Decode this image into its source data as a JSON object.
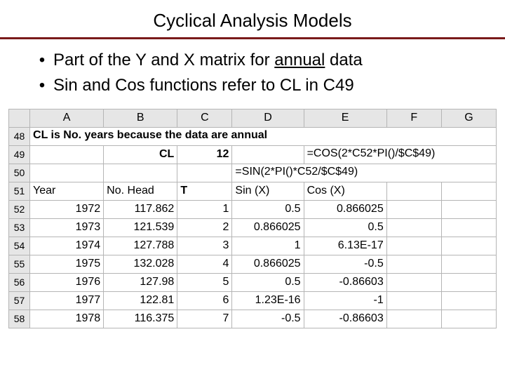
{
  "title": "Cyclical Analysis Models",
  "bullets": [
    {
      "pre": "Part of the Y and X matrix for ",
      "u": "annual",
      "post": " data"
    },
    {
      "pre": "Sin and Cos functions refer to CL in C49",
      "u": "",
      "post": ""
    }
  ],
  "columns": [
    "A",
    "B",
    "C",
    "D",
    "E",
    "F",
    "G"
  ],
  "row_numbers": [
    "48",
    "49",
    "50",
    "51",
    "52",
    "53",
    "54",
    "55",
    "56",
    "57",
    "58"
  ],
  "cells": {
    "r48": {
      "A": "CL is No. years because the data are annual"
    },
    "r49": {
      "B": "CL",
      "C": "12",
      "E": "=COS(2*C52*PI()/$C$49)"
    },
    "r50": {
      "D": "=SIN(2*PI()*C52/$C$49)"
    },
    "r51": {
      "A": "Year",
      "B": "No. Head",
      "C": "T",
      "D": "Sin (X)",
      "E": "Cos (X)"
    },
    "r52": {
      "A": "1972",
      "B": "117.862",
      "C": "1",
      "D": "0.5",
      "E": "0.866025"
    },
    "r53": {
      "A": "1973",
      "B": "121.539",
      "C": "2",
      "D": "0.866025",
      "E": "0.5"
    },
    "r54": {
      "A": "1974",
      "B": "127.788",
      "C": "3",
      "D": "1",
      "E": "6.13E-17"
    },
    "r55": {
      "A": "1975",
      "B": "132.028",
      "C": "4",
      "D": "0.866025",
      "E": "-0.5"
    },
    "r56": {
      "A": "1976",
      "B": "127.98",
      "C": "5",
      "D": "0.5",
      "E": "-0.86603"
    },
    "r57": {
      "A": "1977",
      "B": "122.81",
      "C": "6",
      "D": "1.23E-16",
      "E": "-1"
    },
    "r58": {
      "A": "1978",
      "B": "116.375",
      "C": "7",
      "D": "-0.5",
      "E": "-0.86603"
    }
  },
  "chart_data": {
    "type": "table",
    "title": "Cyclical Analysis Models — Y and X matrix (annual)",
    "note_row48": "CL is No. years because the data are annual",
    "CL": 12,
    "cos_formula": "=COS(2*C52*PI()/$C$49)",
    "sin_formula": "=SIN(2*PI()*C52/$C$49)",
    "headers": [
      "Year",
      "No. Head",
      "T",
      "Sin (X)",
      "Cos (X)"
    ],
    "rows": [
      {
        "Year": 1972,
        "No. Head": 117.862,
        "T": 1,
        "Sin (X)": 0.5,
        "Cos (X)": 0.866025
      },
      {
        "Year": 1973,
        "No. Head": 121.539,
        "T": 2,
        "Sin (X)": 0.866025,
        "Cos (X)": 0.5
      },
      {
        "Year": 1974,
        "No. Head": 127.788,
        "T": 3,
        "Sin (X)": 1,
        "Cos (X)": 6.13e-17
      },
      {
        "Year": 1975,
        "No. Head": 132.028,
        "T": 4,
        "Sin (X)": 0.866025,
        "Cos (X)": -0.5
      },
      {
        "Year": 1976,
        "No. Head": 127.98,
        "T": 5,
        "Sin (X)": 0.5,
        "Cos (X)": -0.86603
      },
      {
        "Year": 1977,
        "No. Head": 122.81,
        "T": 6,
        "Sin (X)": 1.23e-16,
        "Cos (X)": -1
      },
      {
        "Year": 1978,
        "No. Head": 116.375,
        "T": 7,
        "Sin (X)": -0.5,
        "Cos (X)": -0.86603
      }
    ]
  }
}
